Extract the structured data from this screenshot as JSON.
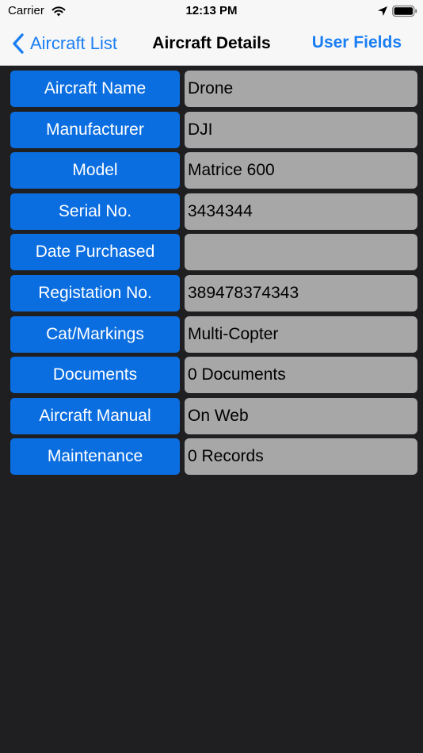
{
  "status": {
    "carrier": "Carrier",
    "time": "12:13 PM",
    "icons": [
      "wifi-icon",
      "location-arrow-icon",
      "battery-icon"
    ]
  },
  "nav": {
    "back_label": "Aircraft List",
    "title": "Aircraft Details",
    "right_label": "User Fields"
  },
  "colors": {
    "accent": "#1a7ef3",
    "label_button": "#0b6ee0",
    "value_box": "#a7a7a7",
    "background": "#1f1f22"
  },
  "fields": [
    {
      "label": "Aircraft Name",
      "value": "Drone"
    },
    {
      "label": "Manufacturer",
      "value": "DJI"
    },
    {
      "label": "Model",
      "value": "Matrice 600"
    },
    {
      "label": "Serial No.",
      "value": "3434344"
    },
    {
      "label": "Date Purchased",
      "value": ""
    },
    {
      "label": "Registation No.",
      "value": "389478374343"
    },
    {
      "label": "Cat/Markings",
      "value": "Multi-Copter"
    },
    {
      "label": "Documents",
      "value": "0 Documents"
    },
    {
      "label": "Aircraft Manual",
      "value": "On Web"
    },
    {
      "label": "Maintenance",
      "value": "0 Records"
    }
  ]
}
